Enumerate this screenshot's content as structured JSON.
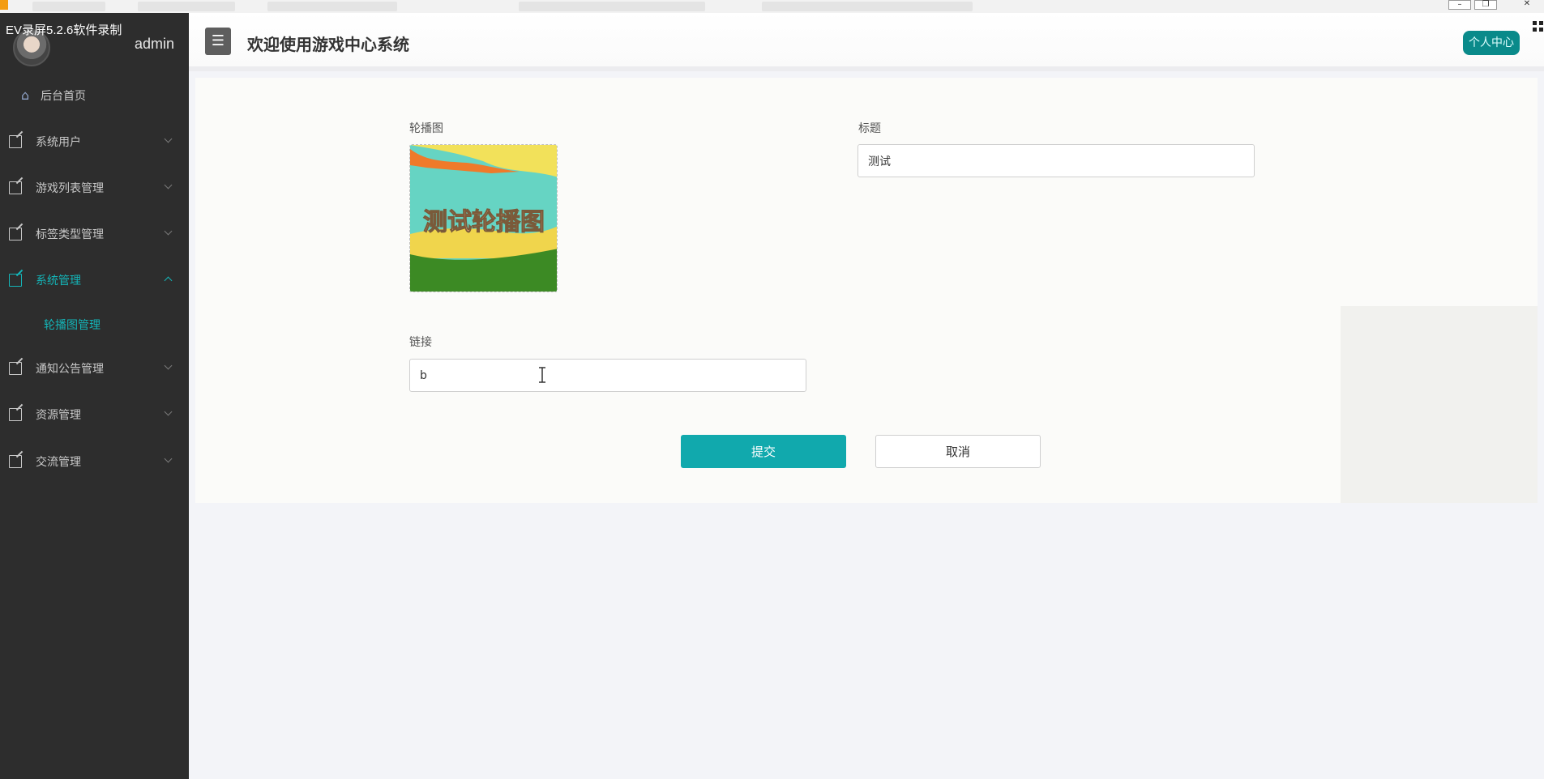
{
  "recorder": {
    "label": "EV录屏5.2.6软件录制"
  },
  "user": {
    "name": "admin"
  },
  "header": {
    "title": "欢迎使用游戏中心系统",
    "menu_icon": "menu-icon",
    "profile_button": "个人中心"
  },
  "sidebar": {
    "home": "后台首页",
    "items": [
      {
        "label": "系统用户",
        "expanded": false
      },
      {
        "label": "游戏列表管理",
        "expanded": false
      },
      {
        "label": "标签类型管理",
        "expanded": false
      },
      {
        "label": "系统管理",
        "expanded": true,
        "children": [
          "轮播图管理"
        ]
      },
      {
        "label": "通知公告管理",
        "expanded": false
      },
      {
        "label": "资源管理",
        "expanded": false
      },
      {
        "label": "交流管理",
        "expanded": false
      }
    ]
  },
  "form": {
    "image_label": "轮播图",
    "image_caption": "测试轮播图",
    "title_label": "标题",
    "title_value": "测试",
    "link_label": "链接",
    "link_value": "b",
    "submit_label": "提交",
    "cancel_label": "取消"
  },
  "colors": {
    "accent": "#11a9ad",
    "sidebar_bg": "#2d2d2d",
    "profile_bg": "#0a8a8a"
  }
}
